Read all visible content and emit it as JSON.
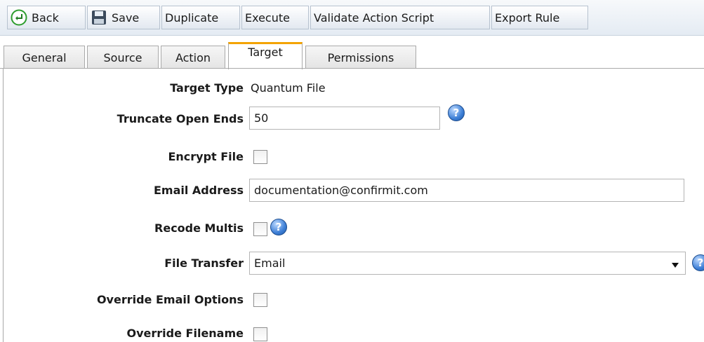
{
  "toolbar": {
    "back_label": "Back",
    "save_label": "Save",
    "duplicate_label": "Duplicate",
    "execute_label": "Execute",
    "validate_label": "Validate Action Script",
    "export_label": "Export Rule"
  },
  "tabs": [
    {
      "label": "General",
      "active": false
    },
    {
      "label": "Source",
      "active": false
    },
    {
      "label": "Action",
      "active": false
    },
    {
      "label": "Target",
      "active": true
    },
    {
      "label": "Permissions",
      "active": false
    }
  ],
  "form": {
    "target_type": {
      "label": "Target Type",
      "value": "Quantum File"
    },
    "truncate_open_ends": {
      "label": "Truncate Open Ends",
      "value": "50"
    },
    "encrypt_file": {
      "label": "Encrypt File",
      "checked": false
    },
    "email_address": {
      "label": "Email Address",
      "value": "documentation@confirmit.com"
    },
    "recode_multis": {
      "label": "Recode Multis",
      "checked": false
    },
    "file_transfer": {
      "label": "File Transfer",
      "value": "Email"
    },
    "override_email_options": {
      "label": "Override Email Options",
      "checked": false
    },
    "override_filename": {
      "label": "Override Filename",
      "checked": false
    }
  },
  "icons": {
    "back": "back-arrow-icon",
    "save": "floppy-disk-icon",
    "help": "help-icon",
    "dropdown": "dropdown-arrow-icon"
  },
  "colors": {
    "active_tab_accent": "#f3a300",
    "help_icon": "#3d7fd6",
    "back_icon": "#2e9d2e"
  }
}
